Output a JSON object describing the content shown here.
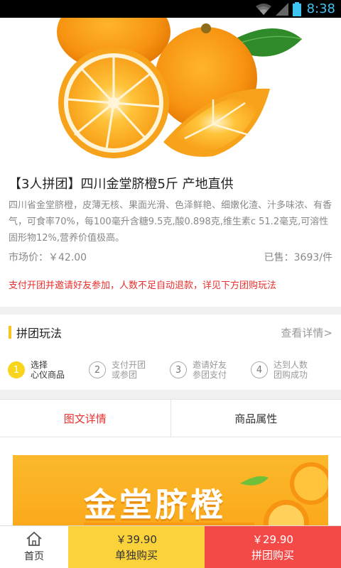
{
  "status_bar": {
    "time": "8:38"
  },
  "product": {
    "title": "【3人拼团】四川金堂脐橙5斤 产地直供",
    "description": "四川省金堂脐橙，皮薄无核、果面光滑、色泽鲜艳、细嫩化渣、汁多味浓、有香气，可食率70%，每100毫升含糖9.5克,酸0.898克,维生素c 51.2毫克,可溶性固形物12%,营养价值极高。",
    "market_price": "市场价：￥42.00",
    "sold": "已售：3693/件",
    "notice": "支付开团并邀请好友参加，人数不足自动退款，详见下方团购玩法"
  },
  "howto": {
    "title": "拼团玩法",
    "more": "查看详情>",
    "steps": [
      {
        "num": "1",
        "line1": "选择",
        "line2": "心仪商品"
      },
      {
        "num": "2",
        "line1": "支付开团",
        "line2": "或参团"
      },
      {
        "num": "3",
        "line1": "邀请好友",
        "line2": "参团支付"
      },
      {
        "num": "4",
        "line1": "达到人数",
        "line2": "团购成功"
      }
    ]
  },
  "tabs": [
    {
      "label": "图文详情"
    },
    {
      "label": "商品属性"
    }
  ],
  "banner": {
    "text": "金堂脐橙"
  },
  "bottom_bar": {
    "home_label": "首页",
    "single": {
      "price": "￥39.90",
      "label": "单独购买"
    },
    "group": {
      "price": "￥29.90",
      "label": "拼团购买"
    }
  },
  "colors": {
    "accent_red": "#e8302e",
    "accent_yellow": "#fbd23a",
    "group_button": "#f34a48",
    "orange": "#f7a21b"
  },
  "icons": [
    "wifi-icon",
    "signal-icon",
    "battery-icon",
    "home-icon",
    "orange-photo"
  ]
}
